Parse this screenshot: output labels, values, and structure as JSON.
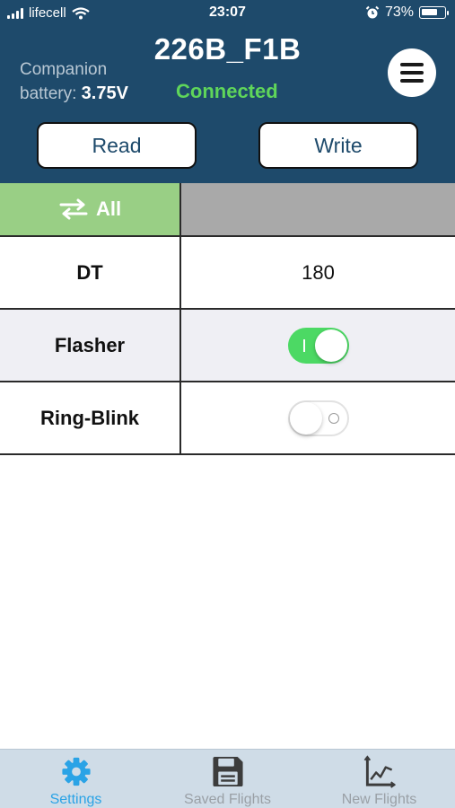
{
  "status_bar": {
    "carrier": "lifecell",
    "time": "23:07",
    "battery_percent": "73%",
    "battery_level": 0.73
  },
  "header": {
    "device_name": "226B_F1B",
    "companion_label_1": "Companion",
    "companion_label_2": "battery:",
    "companion_voltage": "3.75V",
    "connection_status": "Connected",
    "menu_icon": "hamburger-menu-icon"
  },
  "actions": {
    "read_label": "Read",
    "write_label": "Write"
  },
  "settings_table": {
    "all_label": "All",
    "rows": [
      {
        "name": "DT",
        "value": "180"
      },
      {
        "name": "Flasher",
        "toggle": true
      },
      {
        "name": "Ring-Blink",
        "toggle": false
      }
    ]
  },
  "tabbar": {
    "tabs": [
      {
        "label": "Settings",
        "icon": "gear-icon",
        "active": true
      },
      {
        "label": "Saved Flights",
        "icon": "floppy-disk-icon",
        "active": false
      },
      {
        "label": "New Flights",
        "icon": "chart-icon",
        "active": false
      }
    ]
  },
  "colors": {
    "header_bg": "#1e4a6b",
    "connected": "#5fd65a",
    "all_cell": "#99cf85",
    "toggle_on": "#4cd964",
    "tab_active": "#2aa3e6",
    "tabbar_bg": "#cfdce7"
  }
}
